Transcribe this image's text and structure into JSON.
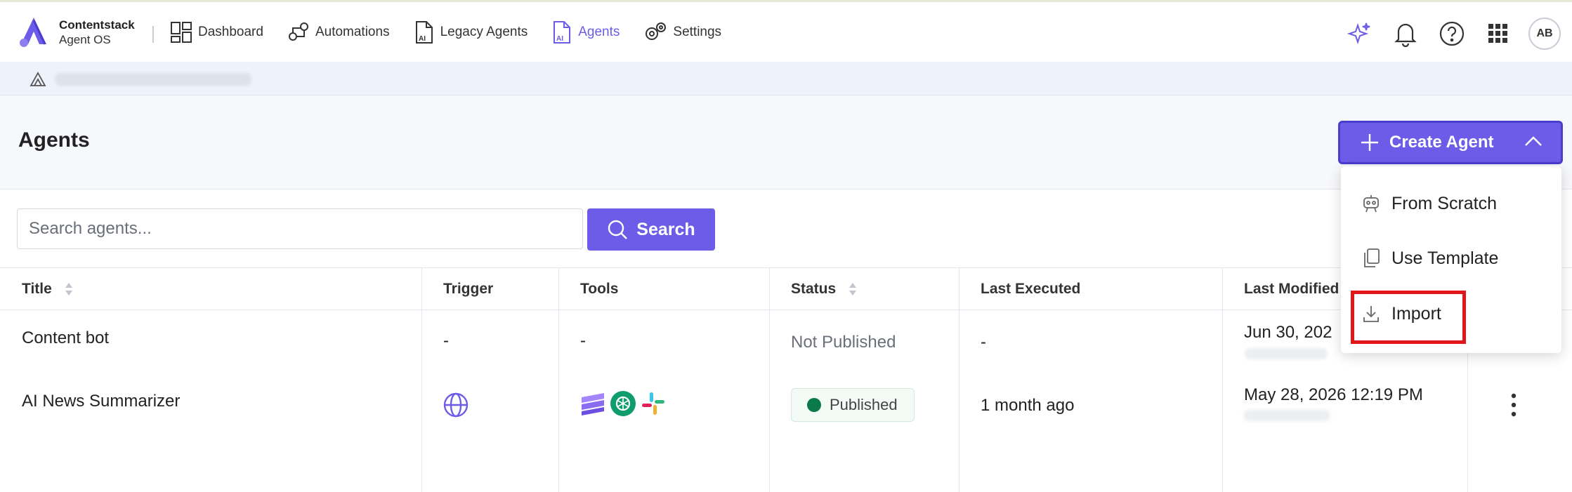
{
  "brand": {
    "name": "Contentstack",
    "product": "Agent OS"
  },
  "nav": {
    "dashboard": "Dashboard",
    "automations": "Automations",
    "legacy_agents": "Legacy Agents",
    "agents": "Agents",
    "settings": "Settings"
  },
  "user": {
    "initials": "AB"
  },
  "page": {
    "title": "Agents",
    "create_label": "Create Agent"
  },
  "create_menu": {
    "items": [
      "From Scratch",
      "Use Template",
      "Import"
    ]
  },
  "search": {
    "placeholder": "Search agents...",
    "button_label": "Search"
  },
  "table": {
    "columns": [
      "Title",
      "Trigger",
      "Tools",
      "Status",
      "Last Executed",
      "Last Modified"
    ],
    "rows": [
      {
        "title": "Content bot",
        "trigger": "-",
        "tools": "-",
        "status": "Not Published",
        "last_executed": "-",
        "last_modified": "Jun 30, 202"
      },
      {
        "title": "AI News Summarizer",
        "trigger": "globe-icon",
        "tools": [
          "stack-icon",
          "openai-icon",
          "slack-icon"
        ],
        "status": "Published",
        "last_executed": "1 month ago",
        "last_modified": "May 28, 2026 12:19 PM"
      }
    ]
  },
  "colors": {
    "accent": "#6c5ce7",
    "published": "#0b7a4b",
    "highlight": "#e0161b"
  }
}
